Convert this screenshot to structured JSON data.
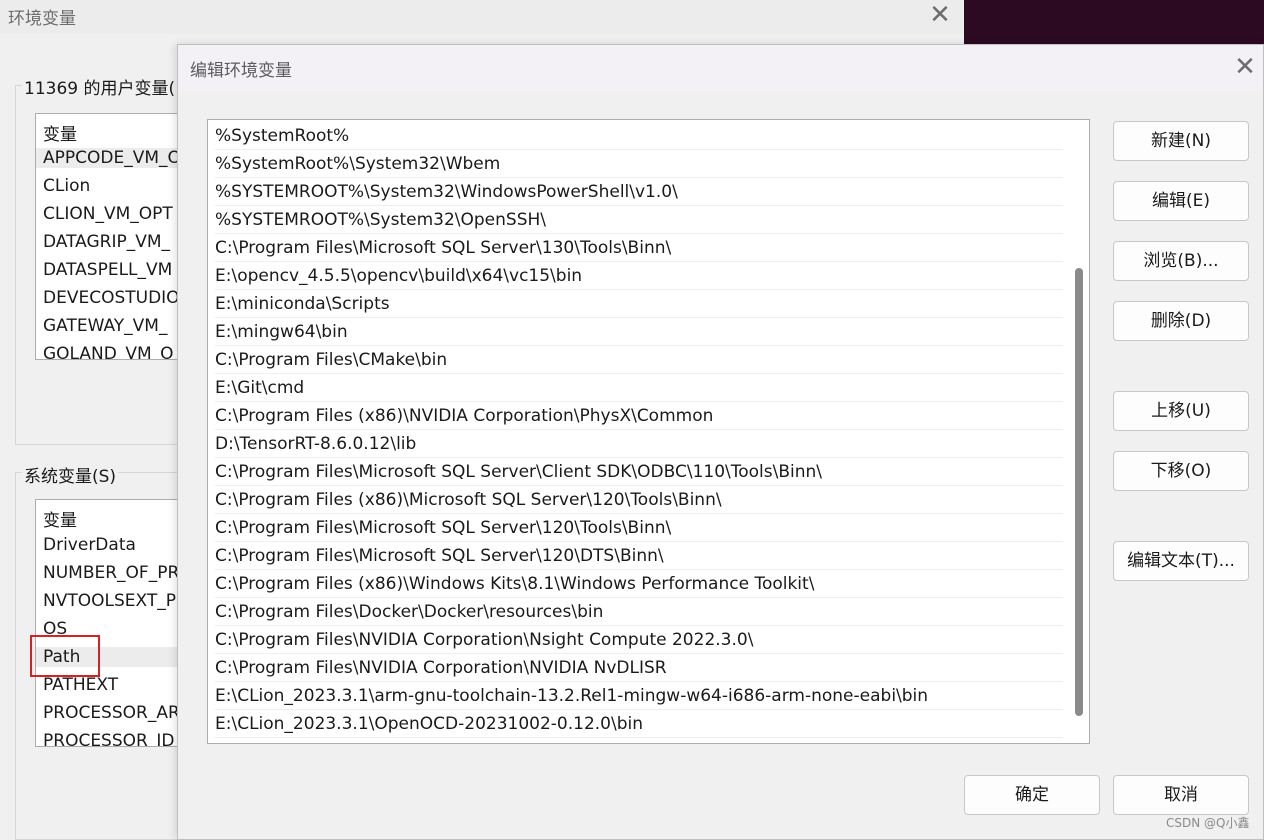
{
  "background_window": {
    "title": "环境变量",
    "user_vars_label": "11369 的用户变量(",
    "user_vars_header": "变量",
    "user_vars": [
      "APPCODE_VM_O",
      "CLion",
      "CLION_VM_OPT",
      "DATAGRIP_VM_",
      "DATASPELL_VM",
      "DEVECOSTUDIO",
      "GATEWAY_VM_",
      "GOLAND_VM_O"
    ],
    "system_vars_label": "系统变量(S)",
    "system_vars_header": "变量",
    "system_vars": [
      "DriverData",
      "NUMBER_OF_PR",
      "NVTOOLSEXT_P",
      "OS",
      "Path",
      "PATHEXT",
      "PROCESSOR_AR",
      "PROCESSOR_ID"
    ],
    "selected_system_var": "Path"
  },
  "dialog": {
    "title": "编辑环境变量",
    "paths": [
      "%SystemRoot%",
      "%SystemRoot%\\System32\\Wbem",
      "%SYSTEMROOT%\\System32\\WindowsPowerShell\\v1.0\\",
      "%SYSTEMROOT%\\System32\\OpenSSH\\",
      "C:\\Program Files\\Microsoft SQL Server\\130\\Tools\\Binn\\",
      "E:\\opencv_4.5.5\\opencv\\build\\x64\\vc15\\bin",
      "E:\\miniconda\\Scripts",
      "E:\\mingw64\\bin",
      "C:\\Program Files\\CMake\\bin",
      "E:\\Git\\cmd",
      "C:\\Program Files (x86)\\NVIDIA Corporation\\PhysX\\Common",
      "D:\\TensorRT-8.6.0.12\\lib",
      "C:\\Program Files\\Microsoft SQL Server\\Client SDK\\ODBC\\110\\Tools\\Binn\\",
      "C:\\Program Files (x86)\\Microsoft SQL Server\\120\\Tools\\Binn\\",
      "C:\\Program Files\\Microsoft SQL Server\\120\\Tools\\Binn\\",
      "C:\\Program Files\\Microsoft SQL Server\\120\\DTS\\Binn\\",
      "C:\\Program Files (x86)\\Windows Kits\\8.1\\Windows Performance Toolkit\\",
      "C:\\Program Files\\Docker\\Docker\\resources\\bin",
      "C:\\Program Files\\NVIDIA Corporation\\Nsight Compute 2022.3.0\\",
      "C:\\Program Files\\NVIDIA Corporation\\NVIDIA NvDLISR",
      "E:\\CLion_2023.3.1\\arm-gnu-toolchain-13.2.Rel1-mingw-w64-i686-arm-none-eabi\\bin",
      "E:\\CLion_2023.3.1\\OpenOCD-20231002-0.12.0\\bin"
    ],
    "buttons": {
      "new": "新建(N)",
      "edit": "编辑(E)",
      "browse": "浏览(B)...",
      "delete": "删除(D)",
      "move_up": "上移(U)",
      "move_down": "下移(O)",
      "edit_text": "编辑文本(T)...",
      "ok": "确定",
      "cancel": "取消"
    }
  },
  "watermark": "CSDN @Q小鑫",
  "colors": {
    "highlight_red": "#d42121",
    "dark_background": "#2b0a22"
  }
}
